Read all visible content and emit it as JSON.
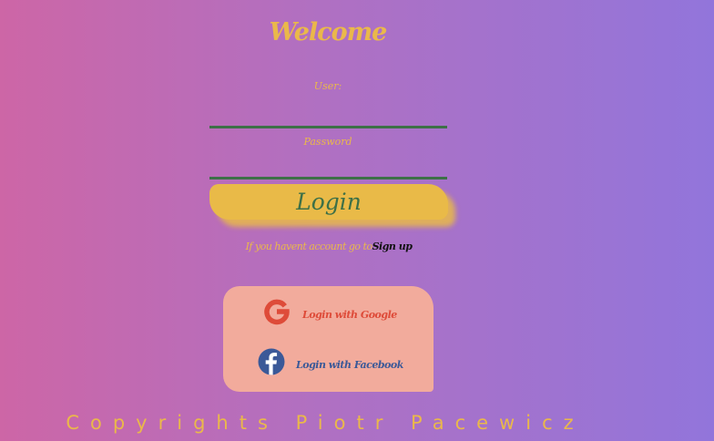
{
  "login_form": {
    "title": "Welcome",
    "user_label": "User:",
    "password_label": "Password",
    "user_value": "",
    "password_value": "",
    "login_button": "Login",
    "signup_prompt": "If you havent account go to",
    "signup_link": "Sign up"
  },
  "social_login": {
    "google": {
      "icon": "google-icon",
      "label": "Login with Google"
    },
    "facebook": {
      "icon": "facebook-icon",
      "label": "Login with Facebook"
    }
  },
  "footer": {
    "copyright": "Copyrights Piotr Pacewicz"
  },
  "colors": {
    "background_start": "#cd66a6",
    "background_end": "#9275db",
    "accent_gold": "#eab84a",
    "accent_green": "#3d7047",
    "social_panel": "#f2ab9c",
    "google_red": "#de4b39",
    "facebook_blue": "#3b5998"
  }
}
